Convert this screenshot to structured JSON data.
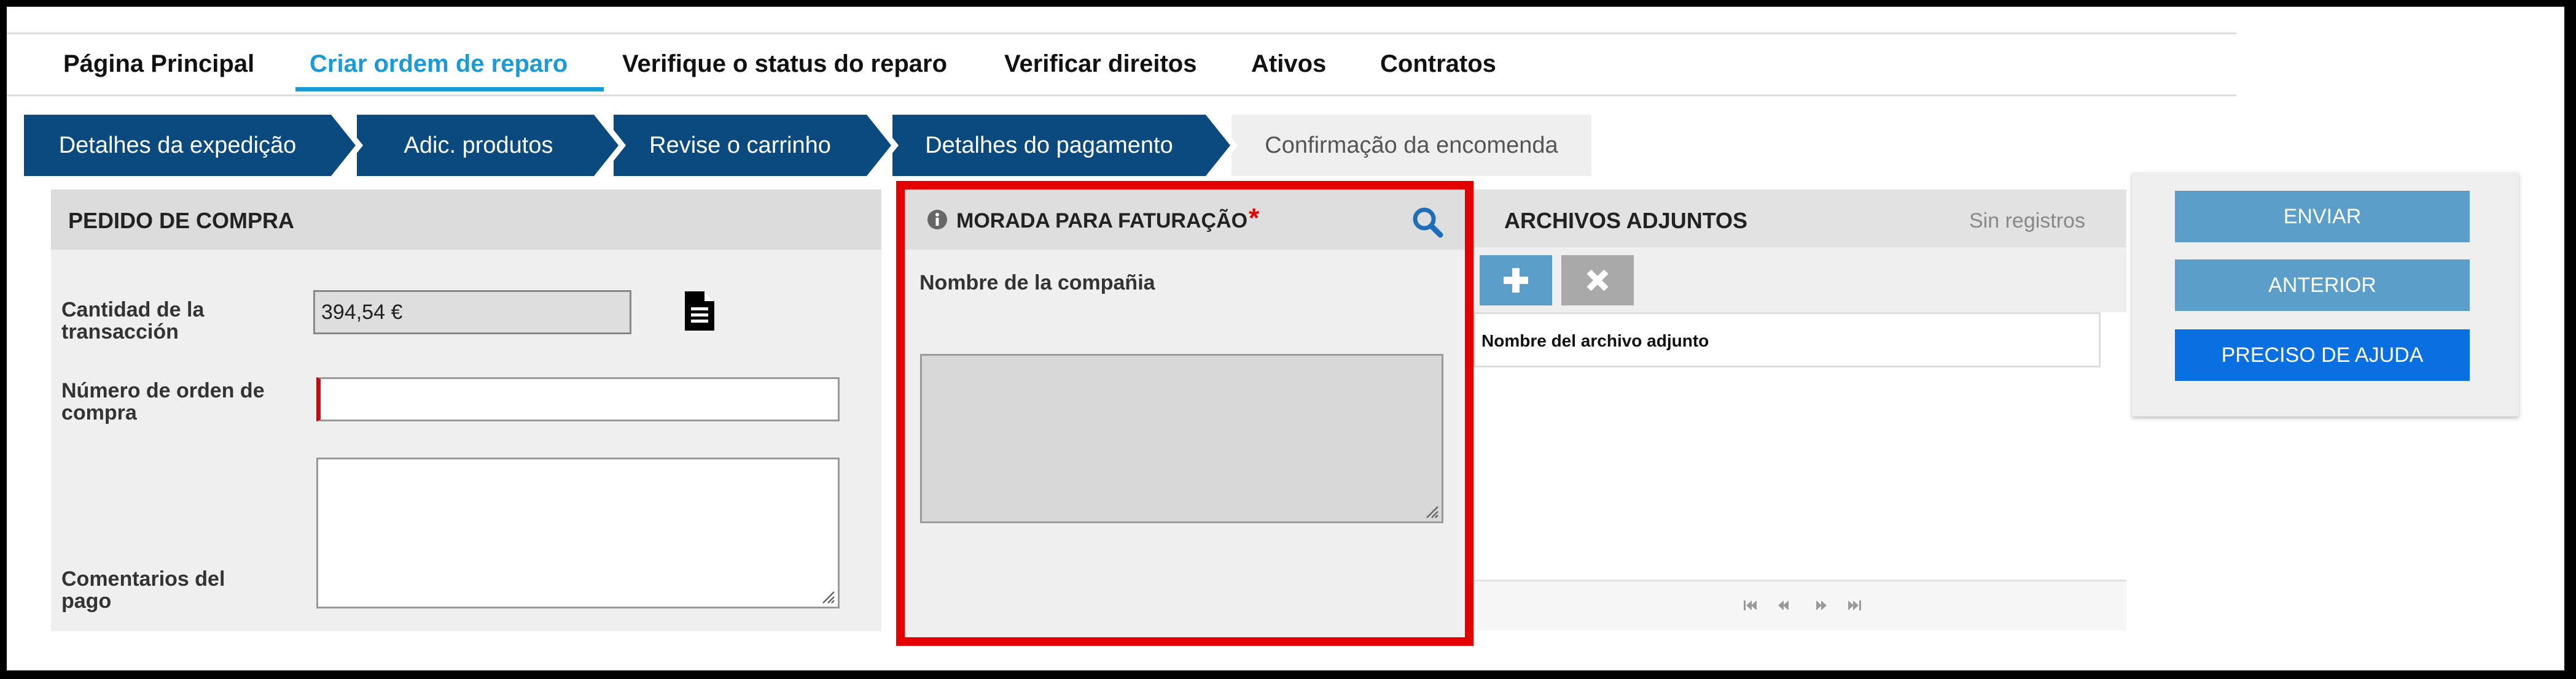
{
  "nav": {
    "items": [
      {
        "label": "Página Principal"
      },
      {
        "label": "Criar ordem de reparo",
        "active": true
      },
      {
        "label": "Verifique o status do reparo"
      },
      {
        "label": "Verificar direitos"
      },
      {
        "label": "Ativos"
      },
      {
        "label": "Contratos"
      }
    ]
  },
  "steps": [
    {
      "label": "Detalhes da expedição",
      "state": "done"
    },
    {
      "label": "Adic. produtos",
      "state": "done"
    },
    {
      "label": "Revise o carrinho",
      "state": "done"
    },
    {
      "label": "Detalhes do pagamento",
      "state": "done"
    },
    {
      "label": "Confirmação da encomenda",
      "state": "current"
    }
  ],
  "purchase_order": {
    "title": "PEDIDO DE COMPRA",
    "amount_label_1": "Cantidad de la",
    "amount_label_2": "transacción",
    "amount_value": "394,54 €",
    "po_label_1": "Número de orden de",
    "po_label_2": "compra",
    "po_value": "",
    "comments_label_1": "Comentarios del",
    "comments_label_2": "pago",
    "comments_value": "",
    "document_icon": "document-icon"
  },
  "billing": {
    "title": "MORADA PARA FATURAÇÃO",
    "required_mark": "*",
    "company_label": "Nombre de la compañia",
    "address_value": "",
    "info_icon": "info-icon",
    "search_icon": "search-icon"
  },
  "attachments": {
    "title": "ARCHIVOS ADJUNTOS",
    "status": "Sin registros",
    "column": "Nombre del archivo adjunto",
    "add_icon": "plus-icon",
    "remove_icon": "close-icon"
  },
  "actions": {
    "submit": "ENVIAR",
    "previous": "ANTERIOR",
    "help": "PRECISO DE AJUDA"
  },
  "colors": {
    "accent": "#1a9ad6",
    "step": "#0b4a7e",
    "highlight": "#e50000",
    "required": "#d8000c",
    "button_light": "#5b9ec9",
    "button_primary": "#0a6fe0"
  }
}
